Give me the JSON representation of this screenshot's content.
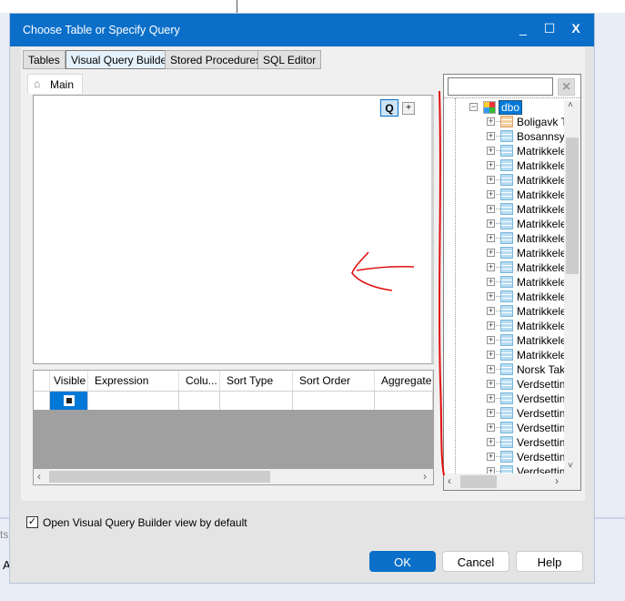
{
  "dialog": {
    "title": "Choose Table or Specify Query",
    "minimize": "_",
    "maximize": "☐",
    "close": "X"
  },
  "tabs": [
    {
      "label": "Tables"
    },
    {
      "label": "Visual Query Builder"
    },
    {
      "label": "Stored Procedures"
    },
    {
      "label": "SQL Editor"
    }
  ],
  "builder": {
    "main_tab": "Main",
    "q_button": "Q",
    "add_button": "+"
  },
  "grid": {
    "columns": [
      "Visible",
      "Expression",
      "Colu...",
      "Sort Type",
      "Sort Order",
      "Aggregate"
    ]
  },
  "tree": {
    "search_value": "",
    "clear": "×",
    "schema": "dbo",
    "items": [
      "Boligavk T",
      "Bosannsyn",
      "Matrikkelen",
      "Matrikkelen",
      "Matrikkelen",
      "Matrikkelen",
      "Matrikkelen",
      "Matrikkelen",
      "Matrikkelen",
      "Matrikkelen",
      "Matrikkelen",
      "Matrikkelen",
      "Matrikkelen",
      "Matrikkelen",
      "Matrikkelen",
      "Matrikkelen",
      "Matrikkelen",
      "Norsk Taks",
      "Verdsetting",
      "Verdsetting",
      "Verdsetting",
      "Verdsetting",
      "Verdsetting",
      "Verdsetting",
      "Verdsetting"
    ]
  },
  "footer": {
    "checkbox_label": "Open Visual Query Builder view by default",
    "checked": true,
    "ok": "OK",
    "cancel": "Cancel",
    "help": "Help"
  },
  "background": {
    "text1": "ts",
    "text2": "A"
  },
  "colors": {
    "accent": "#0b6fc9",
    "annotation": "#e01010"
  }
}
